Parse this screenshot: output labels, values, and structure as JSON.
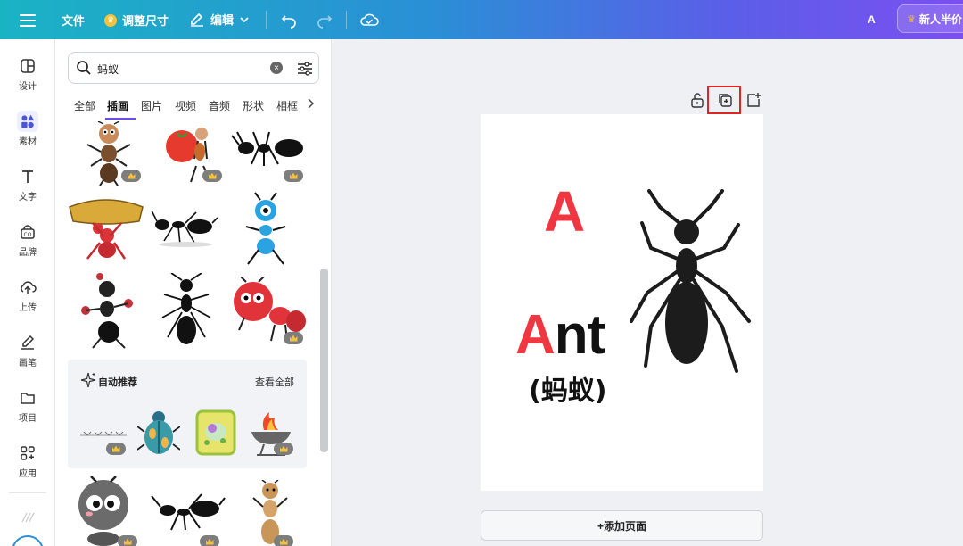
{
  "topbar": {
    "file_label": "文件",
    "resize_label": "调整尺寸",
    "edit_label": "编辑",
    "user_initial": "A",
    "promo_label": "新人半价"
  },
  "rail": {
    "items": [
      {
        "label": "设计",
        "icon": "layout-icon"
      },
      {
        "label": "素材",
        "icon": "shapes-icon"
      },
      {
        "label": "文字",
        "icon": "text-icon"
      },
      {
        "label": "品牌",
        "icon": "brand-icon"
      },
      {
        "label": "上传",
        "icon": "upload-icon"
      },
      {
        "label": "画笔",
        "icon": "pen-icon"
      },
      {
        "label": "项目",
        "icon": "folder-icon"
      },
      {
        "label": "应用",
        "icon": "apps-icon"
      }
    ],
    "active_index": 1
  },
  "panel": {
    "search": {
      "value": "蚂蚁"
    },
    "tabs": [
      "全部",
      "插画",
      "图片",
      "视频",
      "音频",
      "形状",
      "相框"
    ],
    "active_tab": 1,
    "recommend": {
      "title": "自动推荐",
      "view_all": "查看全部"
    }
  },
  "canvas": {
    "big_letter": "A",
    "word_first": "A",
    "word_rest": "nt",
    "word_cn": "(蚂蚁)",
    "add_page_label": "+添加页面"
  },
  "colors": {
    "accent": "#6b4cf0",
    "letter_red": "#f03640",
    "highlight": "#e02424"
  }
}
